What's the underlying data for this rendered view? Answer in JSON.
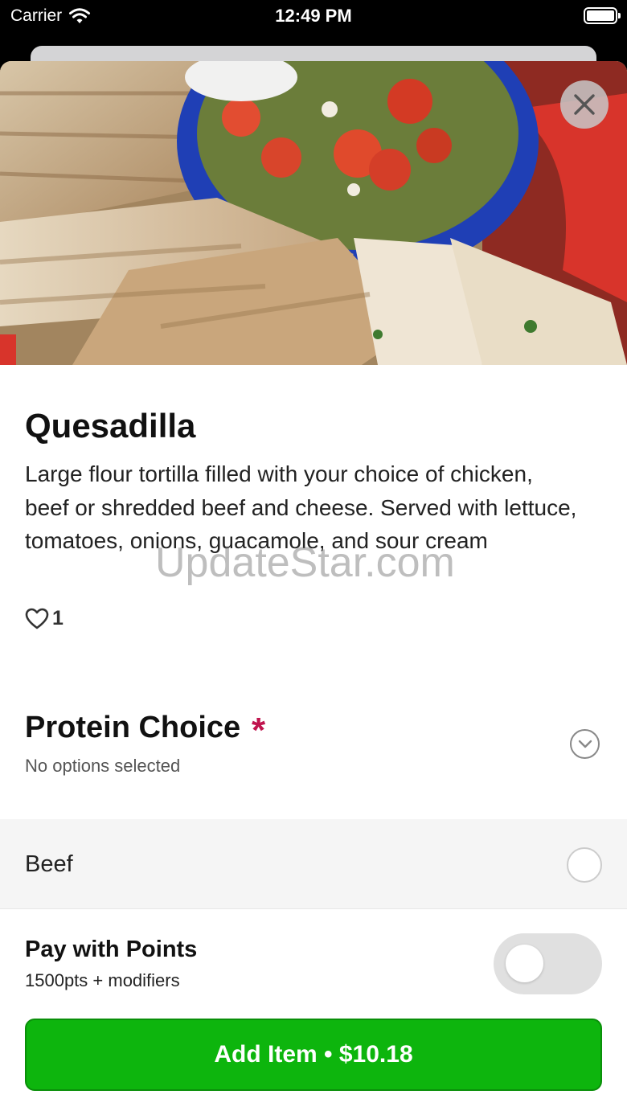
{
  "status_bar": {
    "carrier": "Carrier",
    "time": "12:49 PM"
  },
  "item": {
    "title": "Quesadilla",
    "description": "Large flour tortilla filled with your choice of chicken, beef or shredded beef and cheese. Served with lettuce, tomatoes, onions, guacamole, and sour cream",
    "likes": "1"
  },
  "watermark": "UpdateStar.com",
  "section": {
    "title": "Protein Choice",
    "required_mark": "*",
    "subtitle": "No options selected"
  },
  "options": [
    {
      "label": "Beef",
      "selected": false
    }
  ],
  "footer": {
    "pay_title": "Pay with Points",
    "pay_subtitle": "1500pts + modifiers",
    "pay_with_points_enabled": false,
    "add_button": "Add Item • $10.18"
  },
  "colors": {
    "accent_green": "#0db50d",
    "required_red": "#c0144e"
  },
  "icons": {
    "close": "close-icon",
    "heart": "heart-icon",
    "chevron": "chevron-down-icon",
    "wifi": "wifi-icon",
    "battery": "battery-icon"
  }
}
